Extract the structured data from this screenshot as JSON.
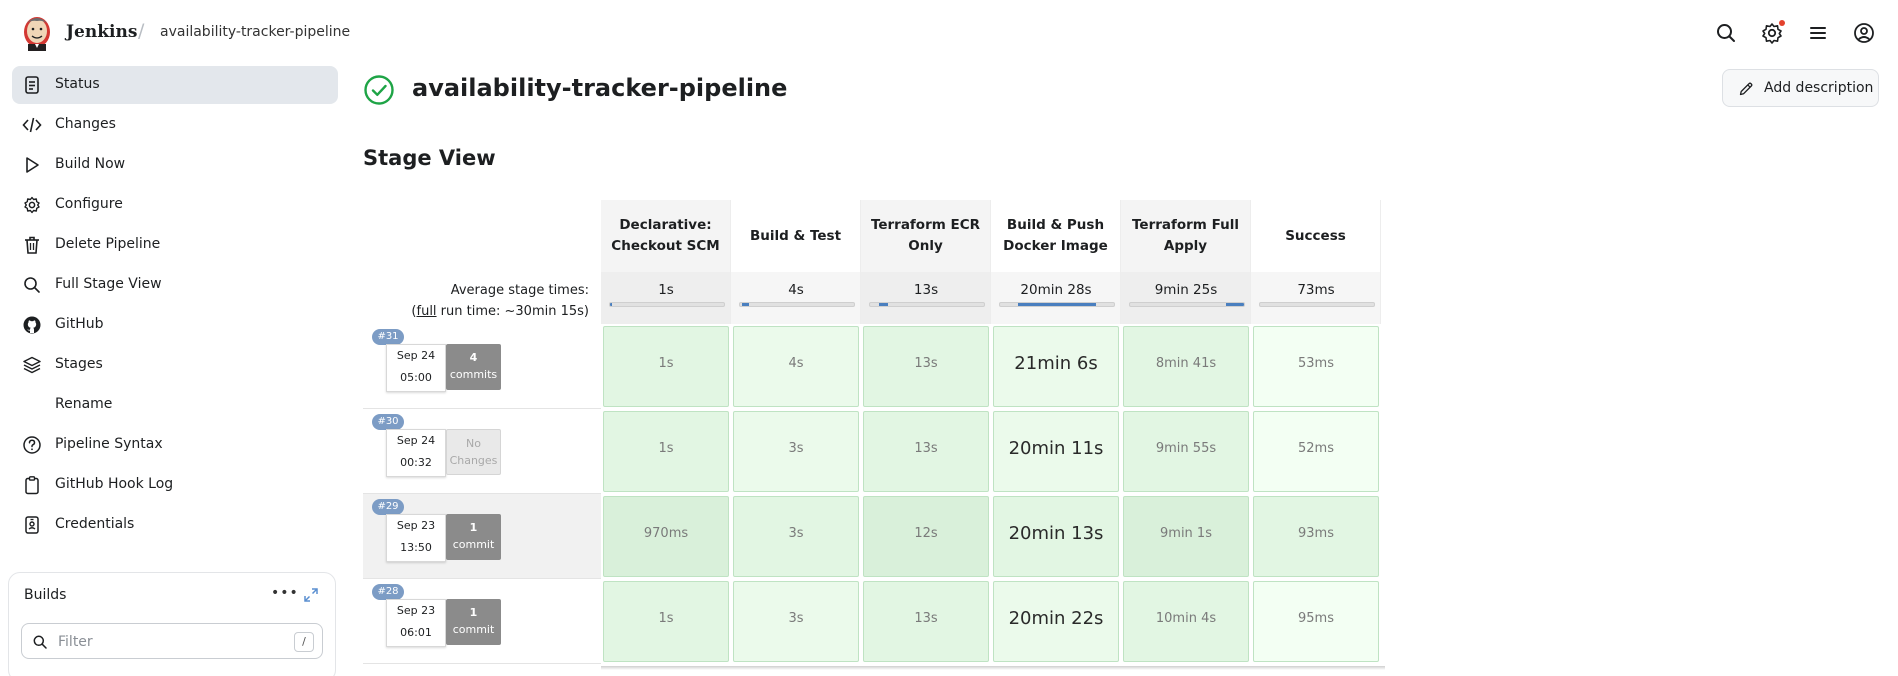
{
  "header": {
    "brand": "Jenkins",
    "breadcrumb": "availability-tracker-pipeline",
    "icons": [
      "search-icon",
      "settings-icon",
      "menu-icon",
      "account-icon"
    ],
    "notification_dot_color": "#e3422d"
  },
  "sidebar": {
    "items": [
      {
        "label": "Status",
        "icon": "status-icon",
        "active": true
      },
      {
        "label": "Changes",
        "icon": "code-icon"
      },
      {
        "label": "Build Now",
        "icon": "play-icon"
      },
      {
        "label": "Configure",
        "icon": "gear-icon"
      },
      {
        "label": "Delete Pipeline",
        "icon": "trash-icon"
      },
      {
        "label": "Full Stage View",
        "icon": "search-icon"
      },
      {
        "label": "GitHub",
        "icon": "github-icon"
      },
      {
        "label": "Stages",
        "icon": "layers-icon"
      },
      {
        "label": "Rename",
        "icon": "rename-icon"
      },
      {
        "label": "Pipeline Syntax",
        "icon": "help-icon"
      },
      {
        "label": "GitHub Hook Log",
        "icon": "clipboard-icon"
      },
      {
        "label": "Credentials",
        "icon": "credentials-icon"
      }
    ],
    "builds": {
      "title": "Builds",
      "more": "•••",
      "filter_placeholder": "Filter",
      "filter_shortcut": "/"
    }
  },
  "main": {
    "title": "availability-tracker-pipeline",
    "status": "success",
    "status_color": "#1ea446",
    "add_description": "Add description",
    "section_title": "Stage View"
  },
  "stage_view": {
    "avg_label": "Average stage times:",
    "full_run_prefix": "(",
    "full_run_link": "full",
    "full_run_suffix": " run time: ~30min 15s)",
    "stages": [
      {
        "name": "Declarative: Checkout SCM",
        "avg": "1s",
        "progress": 0.02
      },
      {
        "name": "Build & Test",
        "avg": "4s",
        "progress": 0.06
      },
      {
        "name": "Terraform ECR Only",
        "avg": "13s",
        "progress": 0.08
      },
      {
        "name": "Build & Push Docker Image",
        "avg": "20min 28s",
        "progress": 0.68
      },
      {
        "name": "Terraform Full Apply",
        "avg": "9min 25s",
        "progress": 0.31
      },
      {
        "name": "Success",
        "avg": "73ms",
        "progress": 0.01
      }
    ],
    "runs": [
      {
        "id": "#31",
        "date": "Sep 24",
        "time": "05:00",
        "commits_count": "4",
        "commits_text": "commits",
        "has_changes": true,
        "durations": [
          "1s",
          "4s",
          "13s",
          "21min 6s",
          "8min 41s",
          "53ms"
        ]
      },
      {
        "id": "#30",
        "date": "Sep 24",
        "time": "00:32",
        "commits_count": "No",
        "commits_text": "Changes",
        "has_changes": false,
        "durations": [
          "1s",
          "3s",
          "13s",
          "20min 11s",
          "9min 55s",
          "52ms"
        ]
      },
      {
        "id": "#29",
        "date": "Sep 23",
        "time": "13:50",
        "commits_count": "1",
        "commits_text": "commit",
        "has_changes": true,
        "durations": [
          "970ms",
          "3s",
          "12s",
          "20min 13s",
          "9min 1s",
          "93ms"
        ]
      },
      {
        "id": "#28",
        "date": "Sep 23",
        "time": "06:01",
        "commits_count": "1",
        "commits_text": "commit",
        "has_changes": true,
        "durations": [
          "1s",
          "3s",
          "13s",
          "20min 22s",
          "10min 4s",
          "95ms"
        ]
      }
    ]
  }
}
